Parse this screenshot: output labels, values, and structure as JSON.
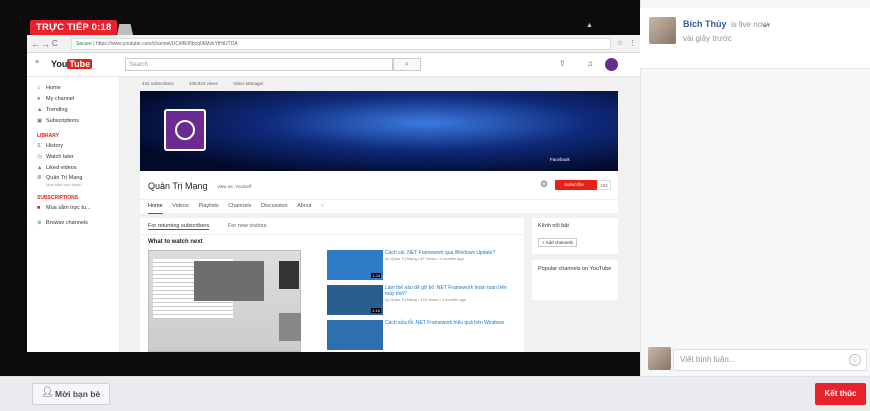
{
  "broadcast": {
    "live_badge": "TRỰC TIẾP 0:18"
  },
  "browser": {
    "url_secure": "Secure",
    "url": "https://www.youtube.com/channel/UCiMEf0bcq06MzkYlHtUTDA"
  },
  "youtube": {
    "logo_you": "You",
    "logo_tube": "Tube",
    "search_placeholder": "Search",
    "stats": [
      "432 subscribers",
      "408,923 views",
      "Video Manager"
    ],
    "sidebar_main": [
      "Home",
      "My channel",
      "Trending",
      "Subscriptions"
    ],
    "library_header": "LIBRARY",
    "sidebar_library": [
      "History",
      "Watch later",
      "Liked videos",
      "Quản Trị Mạng"
    ],
    "library_sub": "Mua sắm trực tuyến",
    "subs_header": "SUBSCRIPTIONS",
    "sub_item": "Mua sắm trực tu...",
    "browse": "Browse channels",
    "channel_name": "Quản Trị Mạng",
    "view_as": "View as: Yourself",
    "subscribe": "Subscribe",
    "sub_count": "432",
    "social": "Facebook",
    "tabs": [
      "Home",
      "Videos",
      "Playlists",
      "Channels",
      "Discussion",
      "About"
    ],
    "sub_tabs": [
      "For returning subscribers",
      "For new visitors"
    ],
    "what_to_watch": "What to watch next",
    "videos": [
      {
        "title": "Cách cài .NET Framework qua Windows Update?",
        "meta": "by Quản Trị Mạng • 87 views • 4 months ago",
        "dur": "1:24"
      },
      {
        "title": "Làm thế nào để gỡ bỏ .NET Framework hoàn toàn trên máy tính?",
        "meta": "by Quản Trị Mạng • 424 views • 4 months ago",
        "dur": "2:16"
      },
      {
        "title": "Cách sửa lỗi .NET Framework hiệu quả trên Windows",
        "meta": "",
        "dur": ""
      }
    ],
    "featured_header": "Kênh nổi bật",
    "add_channels": "+ Add channels",
    "popular_header": "Popular channels on YouTube"
  },
  "panel": {
    "user_name": "Bích Thủy",
    "status": "is live now.",
    "time_ago": "vài giây trước",
    "comment_placeholder": "Viết bình luận..."
  },
  "bottom": {
    "invite_label": "Mời bạn bè",
    "end_label": "Kết thúc"
  },
  "colors": {
    "live_red": "#e8212a",
    "fb_blue": "#365899",
    "yt_red": "#e62117"
  }
}
